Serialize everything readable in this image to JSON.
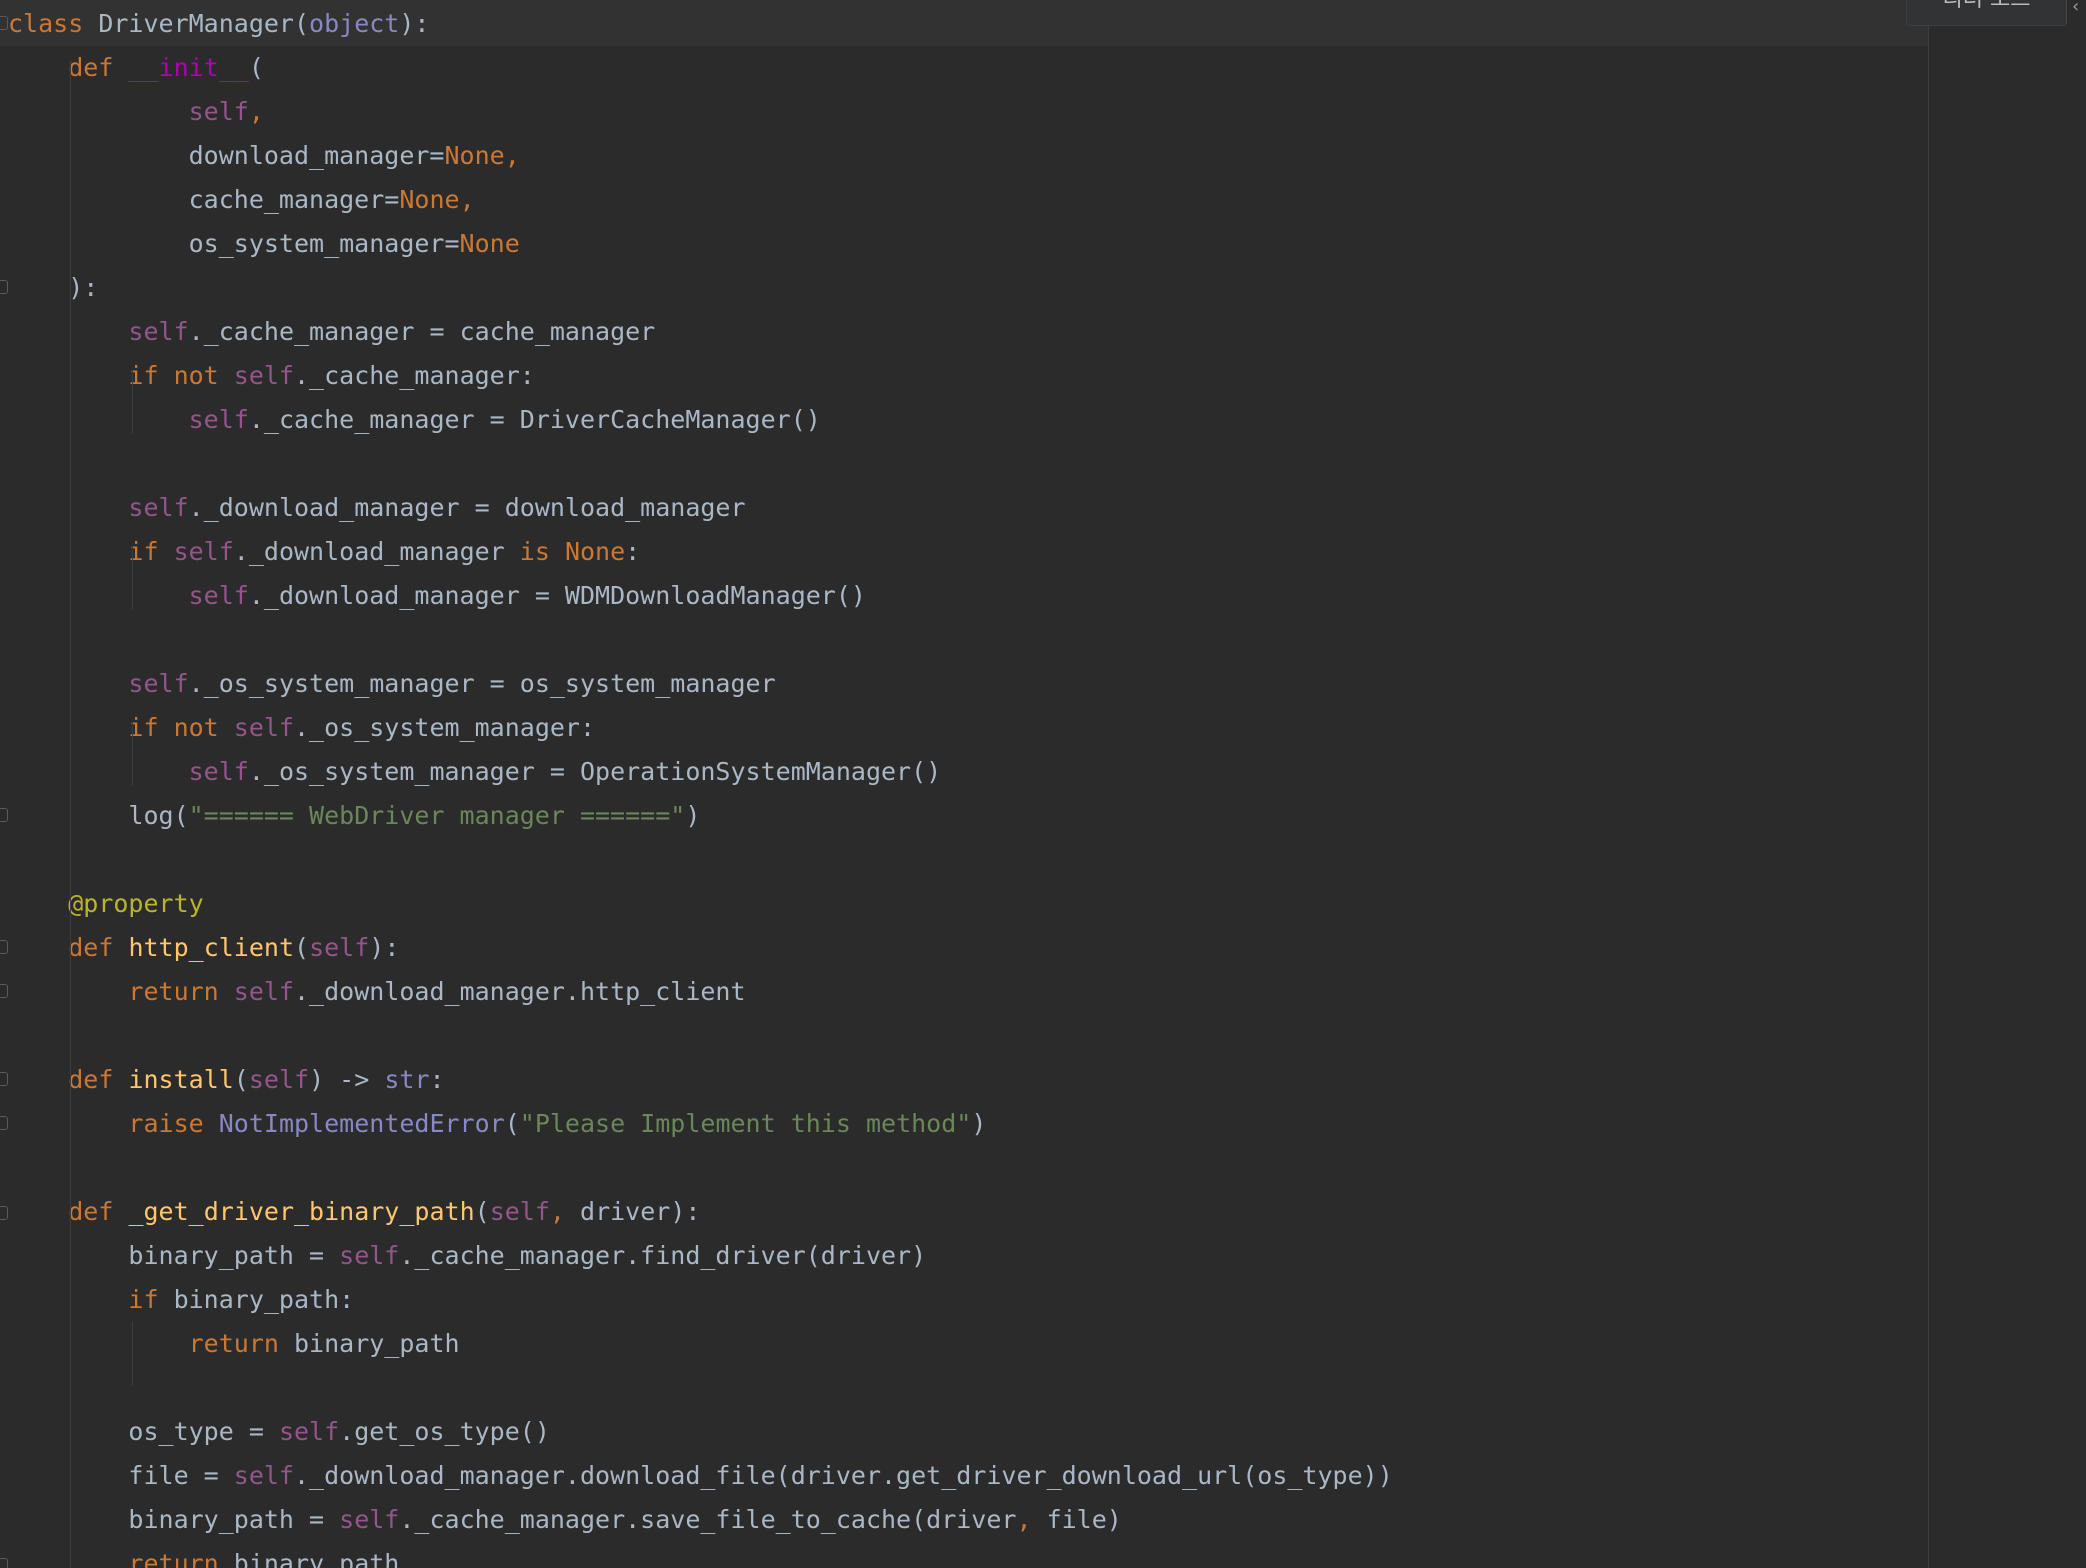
{
  "editor": {
    "reader_mode_label": "리더 모드",
    "language": "python",
    "colors": {
      "background": "#2b2b2b",
      "keyword": "#cc7832",
      "self": "#94558d",
      "builtin": "#8888c6",
      "string": "#6a8759",
      "decorator": "#bbb529",
      "function": "#ffc66d",
      "magic": "#b200b2",
      "identifier": "#a9b7c6"
    }
  },
  "code_lines": [
    {
      "tokens": [
        [
          "kw",
          "class"
        ],
        [
          "id",
          " DriverManager("
        ],
        [
          "builtin",
          "object"
        ],
        [
          "id",
          "):"
        ]
      ]
    },
    {
      "tokens": [
        [
          "id",
          "    "
        ],
        [
          "kw",
          "def "
        ],
        [
          "magic",
          "__init__"
        ],
        [
          "id",
          "("
        ]
      ]
    },
    {
      "tokens": [
        [
          "id",
          "            "
        ],
        [
          "self",
          "self"
        ],
        [
          "kw",
          ","
        ]
      ]
    },
    {
      "tokens": [
        [
          "id",
          "            download_manager="
        ],
        [
          "none",
          "None"
        ],
        [
          "kw",
          ","
        ]
      ]
    },
    {
      "tokens": [
        [
          "id",
          "            cache_manager="
        ],
        [
          "none",
          "None"
        ],
        [
          "kw",
          ","
        ]
      ]
    },
    {
      "tokens": [
        [
          "id",
          "            os_system_manager="
        ],
        [
          "none",
          "None"
        ]
      ]
    },
    {
      "tokens": [
        [
          "id",
          "    ):"
        ]
      ]
    },
    {
      "tokens": [
        [
          "id",
          "        "
        ],
        [
          "self",
          "self"
        ],
        [
          "id",
          "._cache_manager = cache_manager"
        ]
      ]
    },
    {
      "tokens": [
        [
          "id",
          "        "
        ],
        [
          "kw",
          "if not "
        ],
        [
          "self",
          "self"
        ],
        [
          "id",
          "._cache_manager:"
        ]
      ]
    },
    {
      "tokens": [
        [
          "id",
          "            "
        ],
        [
          "self",
          "self"
        ],
        [
          "id",
          "._cache_manager = DriverCacheManager()"
        ]
      ]
    },
    {
      "tokens": []
    },
    {
      "tokens": [
        [
          "id",
          "        "
        ],
        [
          "self",
          "self"
        ],
        [
          "id",
          "._download_manager = download_manager"
        ]
      ]
    },
    {
      "tokens": [
        [
          "id",
          "        "
        ],
        [
          "kw",
          "if "
        ],
        [
          "self",
          "self"
        ],
        [
          "id",
          "._download_manager "
        ],
        [
          "kw",
          "is "
        ],
        [
          "none",
          "None"
        ],
        [
          "id",
          ":"
        ]
      ]
    },
    {
      "tokens": [
        [
          "id",
          "            "
        ],
        [
          "self",
          "self"
        ],
        [
          "id",
          "._download_manager = WDMDownloadManager()"
        ]
      ]
    },
    {
      "tokens": []
    },
    {
      "tokens": [
        [
          "id",
          "        "
        ],
        [
          "self",
          "self"
        ],
        [
          "id",
          "._os_system_manager = os_system_manager"
        ]
      ]
    },
    {
      "tokens": [
        [
          "id",
          "        "
        ],
        [
          "kw",
          "if not "
        ],
        [
          "self",
          "self"
        ],
        [
          "id",
          "._os_system_manager:"
        ]
      ]
    },
    {
      "tokens": [
        [
          "id",
          "            "
        ],
        [
          "self",
          "self"
        ],
        [
          "id",
          "._os_system_manager = OperationSystemManager()"
        ]
      ]
    },
    {
      "tokens": [
        [
          "id",
          "        log("
        ],
        [
          "str",
          "\"====== WebDriver manager ======\""
        ],
        [
          "id",
          ")"
        ]
      ]
    },
    {
      "tokens": []
    },
    {
      "tokens": [
        [
          "id",
          "    "
        ],
        [
          "dec",
          "@property"
        ]
      ]
    },
    {
      "tokens": [
        [
          "id",
          "    "
        ],
        [
          "kw",
          "def "
        ],
        [
          "fn",
          "http_client"
        ],
        [
          "id",
          "("
        ],
        [
          "self",
          "self"
        ],
        [
          "id",
          "):"
        ]
      ]
    },
    {
      "tokens": [
        [
          "id",
          "        "
        ],
        [
          "kw",
          "return "
        ],
        [
          "self",
          "self"
        ],
        [
          "id",
          "._download_manager.http_client"
        ]
      ]
    },
    {
      "tokens": []
    },
    {
      "tokens": [
        [
          "id",
          "    "
        ],
        [
          "kw",
          "def "
        ],
        [
          "fn",
          "install"
        ],
        [
          "id",
          "("
        ],
        [
          "self",
          "self"
        ],
        [
          "id",
          ") -> "
        ],
        [
          "builtin",
          "str"
        ],
        [
          "id",
          ":"
        ]
      ]
    },
    {
      "tokens": [
        [
          "id",
          "        "
        ],
        [
          "kw",
          "raise "
        ],
        [
          "builtin",
          "NotImplementedError"
        ],
        [
          "id",
          "("
        ],
        [
          "str",
          "\"Please Implement this method\""
        ],
        [
          "id",
          ")"
        ]
      ]
    },
    {
      "tokens": []
    },
    {
      "tokens": [
        [
          "id",
          "    "
        ],
        [
          "kw",
          "def "
        ],
        [
          "fn",
          "_get_driver_binary_path"
        ],
        [
          "id",
          "("
        ],
        [
          "self",
          "self"
        ],
        [
          "kw",
          ", "
        ],
        [
          "id",
          "driver):"
        ]
      ]
    },
    {
      "tokens": [
        [
          "id",
          "        binary_path = "
        ],
        [
          "self",
          "self"
        ],
        [
          "id",
          "._cache_manager.find_driver(driver)"
        ]
      ]
    },
    {
      "tokens": [
        [
          "id",
          "        "
        ],
        [
          "kw",
          "if "
        ],
        [
          "id",
          "binary_path:"
        ]
      ]
    },
    {
      "tokens": [
        [
          "id",
          "            "
        ],
        [
          "kw",
          "return "
        ],
        [
          "id",
          "binary_path"
        ]
      ]
    },
    {
      "tokens": []
    },
    {
      "tokens": [
        [
          "id",
          "        os_type = "
        ],
        [
          "self",
          "self"
        ],
        [
          "id",
          ".get_os_type()"
        ]
      ]
    },
    {
      "tokens": [
        [
          "id",
          "        file = "
        ],
        [
          "self",
          "self"
        ],
        [
          "id",
          "._download_manager.download_file(driver.get_driver_download_url(os_type))"
        ]
      ]
    },
    {
      "tokens": [
        [
          "id",
          "        binary_path = "
        ],
        [
          "self",
          "self"
        ],
        [
          "id",
          "._cache_manager.save_file_to_cache(driver"
        ],
        [
          "kw",
          ", "
        ],
        [
          "id",
          "file)"
        ]
      ]
    },
    {
      "tokens": [
        [
          "id",
          "        "
        ],
        [
          "kw",
          "return "
        ],
        [
          "id",
          "binary_path"
        ]
      ]
    }
  ]
}
